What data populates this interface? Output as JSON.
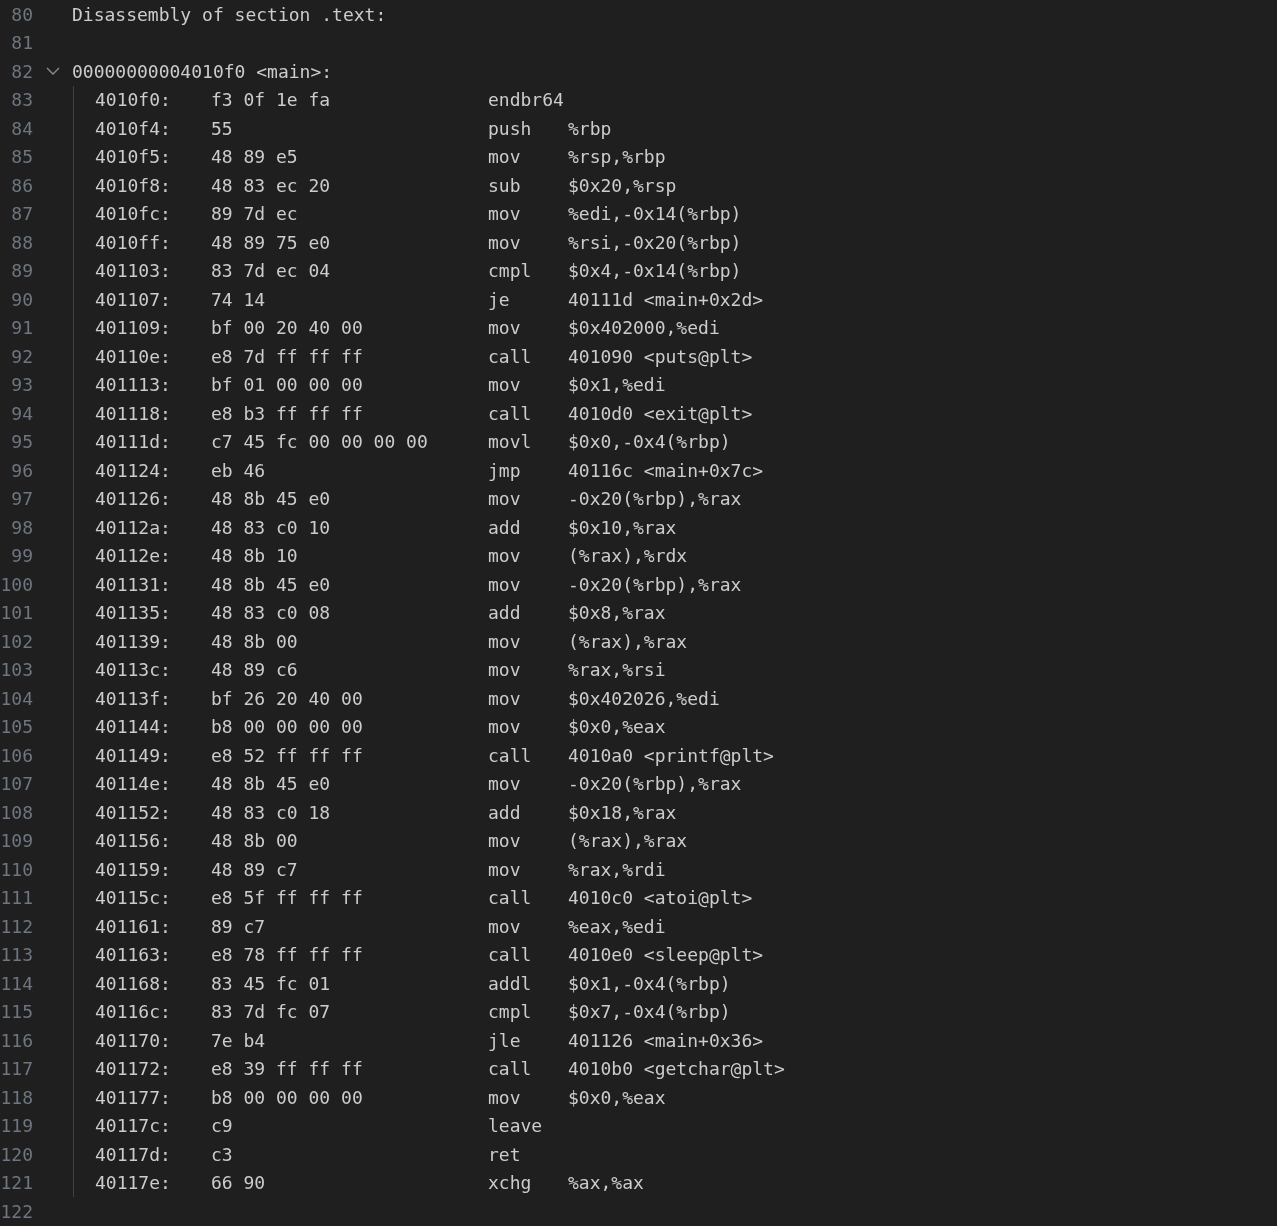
{
  "editor": {
    "lines": [
      {
        "number": "80",
        "kind": "text",
        "text": "Disassembly of section .text:"
      },
      {
        "number": "81",
        "kind": "blank"
      },
      {
        "number": "82",
        "kind": "label",
        "text": "00000000004010f0 <main>:",
        "expanded": true,
        "children": [
          {
            "number": "83",
            "address": "4010f0:",
            "bytes": "f3 0f 1e fa",
            "mnemonic": "endbr64"
          },
          {
            "number": "84",
            "address": "4010f4:",
            "bytes": "55",
            "mnemonic": "push",
            "operands": "%rbp"
          },
          {
            "number": "85",
            "address": "4010f5:",
            "bytes": "48 89 e5",
            "mnemonic": "mov",
            "operands": "%rsp,%rbp"
          },
          {
            "number": "86",
            "address": "4010f8:",
            "bytes": "48 83 ec 20",
            "mnemonic": "sub",
            "operands": "$0x20,%rsp"
          },
          {
            "number": "87",
            "address": "4010fc:",
            "bytes": "89 7d ec",
            "mnemonic": "mov",
            "operands": "%edi,-0x14(%rbp)"
          },
          {
            "number": "88",
            "address": "4010ff:",
            "bytes": "48 89 75 e0",
            "mnemonic": "mov",
            "operands": "%rsi,-0x20(%rbp)"
          },
          {
            "number": "89",
            "address": "401103:",
            "bytes": "83 7d ec 04",
            "mnemonic": "cmpl",
            "operands": "$0x4,-0x14(%rbp)"
          },
          {
            "number": "90",
            "address": "401107:",
            "bytes": "74 14",
            "mnemonic": "je",
            "operands": "40111d <main+0x2d>"
          },
          {
            "number": "91",
            "address": "401109:",
            "bytes": "bf 00 20 40 00",
            "mnemonic": "mov",
            "operands": "$0x402000,%edi"
          },
          {
            "number": "92",
            "address": "40110e:",
            "bytes": "e8 7d ff ff ff",
            "mnemonic": "call",
            "operands": "401090 <puts@plt>"
          },
          {
            "number": "93",
            "address": "401113:",
            "bytes": "bf 01 00 00 00",
            "mnemonic": "mov",
            "operands": "$0x1,%edi"
          },
          {
            "number": "94",
            "address": "401118:",
            "bytes": "e8 b3 ff ff ff",
            "mnemonic": "call",
            "operands": "4010d0 <exit@plt>"
          },
          {
            "number": "95",
            "address": "40111d:",
            "bytes": "c7 45 fc 00 00 00 00",
            "mnemonic": "movl",
            "operands": "$0x0,-0x4(%rbp)"
          },
          {
            "number": "96",
            "address": "401124:",
            "bytes": "eb 46",
            "mnemonic": "jmp",
            "operands": "40116c <main+0x7c>"
          },
          {
            "number": "97",
            "address": "401126:",
            "bytes": "48 8b 45 e0",
            "mnemonic": "mov",
            "operands": "-0x20(%rbp),%rax"
          },
          {
            "number": "98",
            "address": "40112a:",
            "bytes": "48 83 c0 10",
            "mnemonic": "add",
            "operands": "$0x10,%rax"
          },
          {
            "number": "99",
            "address": "40112e:",
            "bytes": "48 8b 10",
            "mnemonic": "mov",
            "operands": "(%rax),%rdx"
          },
          {
            "number": "100",
            "address": "401131:",
            "bytes": "48 8b 45 e0",
            "mnemonic": "mov",
            "operands": "-0x20(%rbp),%rax"
          },
          {
            "number": "101",
            "address": "401135:",
            "bytes": "48 83 c0 08",
            "mnemonic": "add",
            "operands": "$0x8,%rax"
          },
          {
            "number": "102",
            "address": "401139:",
            "bytes": "48 8b 00",
            "mnemonic": "mov",
            "operands": "(%rax),%rax"
          },
          {
            "number": "103",
            "address": "40113c:",
            "bytes": "48 89 c6",
            "mnemonic": "mov",
            "operands": "%rax,%rsi"
          },
          {
            "number": "104",
            "address": "40113f:",
            "bytes": "bf 26 20 40 00",
            "mnemonic": "mov",
            "operands": "$0x402026,%edi"
          },
          {
            "number": "105",
            "address": "401144:",
            "bytes": "b8 00 00 00 00",
            "mnemonic": "mov",
            "operands": "$0x0,%eax"
          },
          {
            "number": "106",
            "address": "401149:",
            "bytes": "e8 52 ff ff ff",
            "mnemonic": "call",
            "operands": "4010a0 <printf@plt>"
          },
          {
            "number": "107",
            "address": "40114e:",
            "bytes": "48 8b 45 e0",
            "mnemonic": "mov",
            "operands": "-0x20(%rbp),%rax"
          },
          {
            "number": "108",
            "address": "401152:",
            "bytes": "48 83 c0 18",
            "mnemonic": "add",
            "operands": "$0x18,%rax"
          },
          {
            "number": "109",
            "address": "401156:",
            "bytes": "48 8b 00",
            "mnemonic": "mov",
            "operands": "(%rax),%rax"
          },
          {
            "number": "110",
            "address": "401159:",
            "bytes": "48 89 c7",
            "mnemonic": "mov",
            "operands": "%rax,%rdi"
          },
          {
            "number": "111",
            "address": "40115c:",
            "bytes": "e8 5f ff ff ff",
            "mnemonic": "call",
            "operands": "4010c0 <atoi@plt>"
          },
          {
            "number": "112",
            "address": "401161:",
            "bytes": "89 c7",
            "mnemonic": "mov",
            "operands": "%eax,%edi"
          },
          {
            "number": "113",
            "address": "401163:",
            "bytes": "e8 78 ff ff ff",
            "mnemonic": "call",
            "operands": "4010e0 <sleep@plt>"
          },
          {
            "number": "114",
            "address": "401168:",
            "bytes": "83 45 fc 01",
            "mnemonic": "addl",
            "operands": "$0x1,-0x4(%rbp)"
          },
          {
            "number": "115",
            "address": "40116c:",
            "bytes": "83 7d fc 07",
            "mnemonic": "cmpl",
            "operands": "$0x7,-0x4(%rbp)"
          },
          {
            "number": "116",
            "address": "401170:",
            "bytes": "7e b4",
            "mnemonic": "jle",
            "operands": "401126 <main+0x36>"
          },
          {
            "number": "117",
            "address": "401172:",
            "bytes": "e8 39 ff ff ff",
            "mnemonic": "call",
            "operands": "4010b0 <getchar@plt>"
          },
          {
            "number": "118",
            "address": "401177:",
            "bytes": "b8 00 00 00 00",
            "mnemonic": "mov",
            "operands": "$0x0,%eax"
          },
          {
            "number": "119",
            "address": "40117c:",
            "bytes": "c9",
            "mnemonic": "leave"
          },
          {
            "number": "120",
            "address": "40117d:",
            "bytes": "c3",
            "mnemonic": "ret"
          },
          {
            "number": "121",
            "address": "40117e:",
            "bytes": "66 90",
            "mnemonic": "xchg",
            "operands": "%ax,%ax"
          }
        ]
      },
      {
        "number": "122",
        "kind": "blank"
      }
    ]
  }
}
